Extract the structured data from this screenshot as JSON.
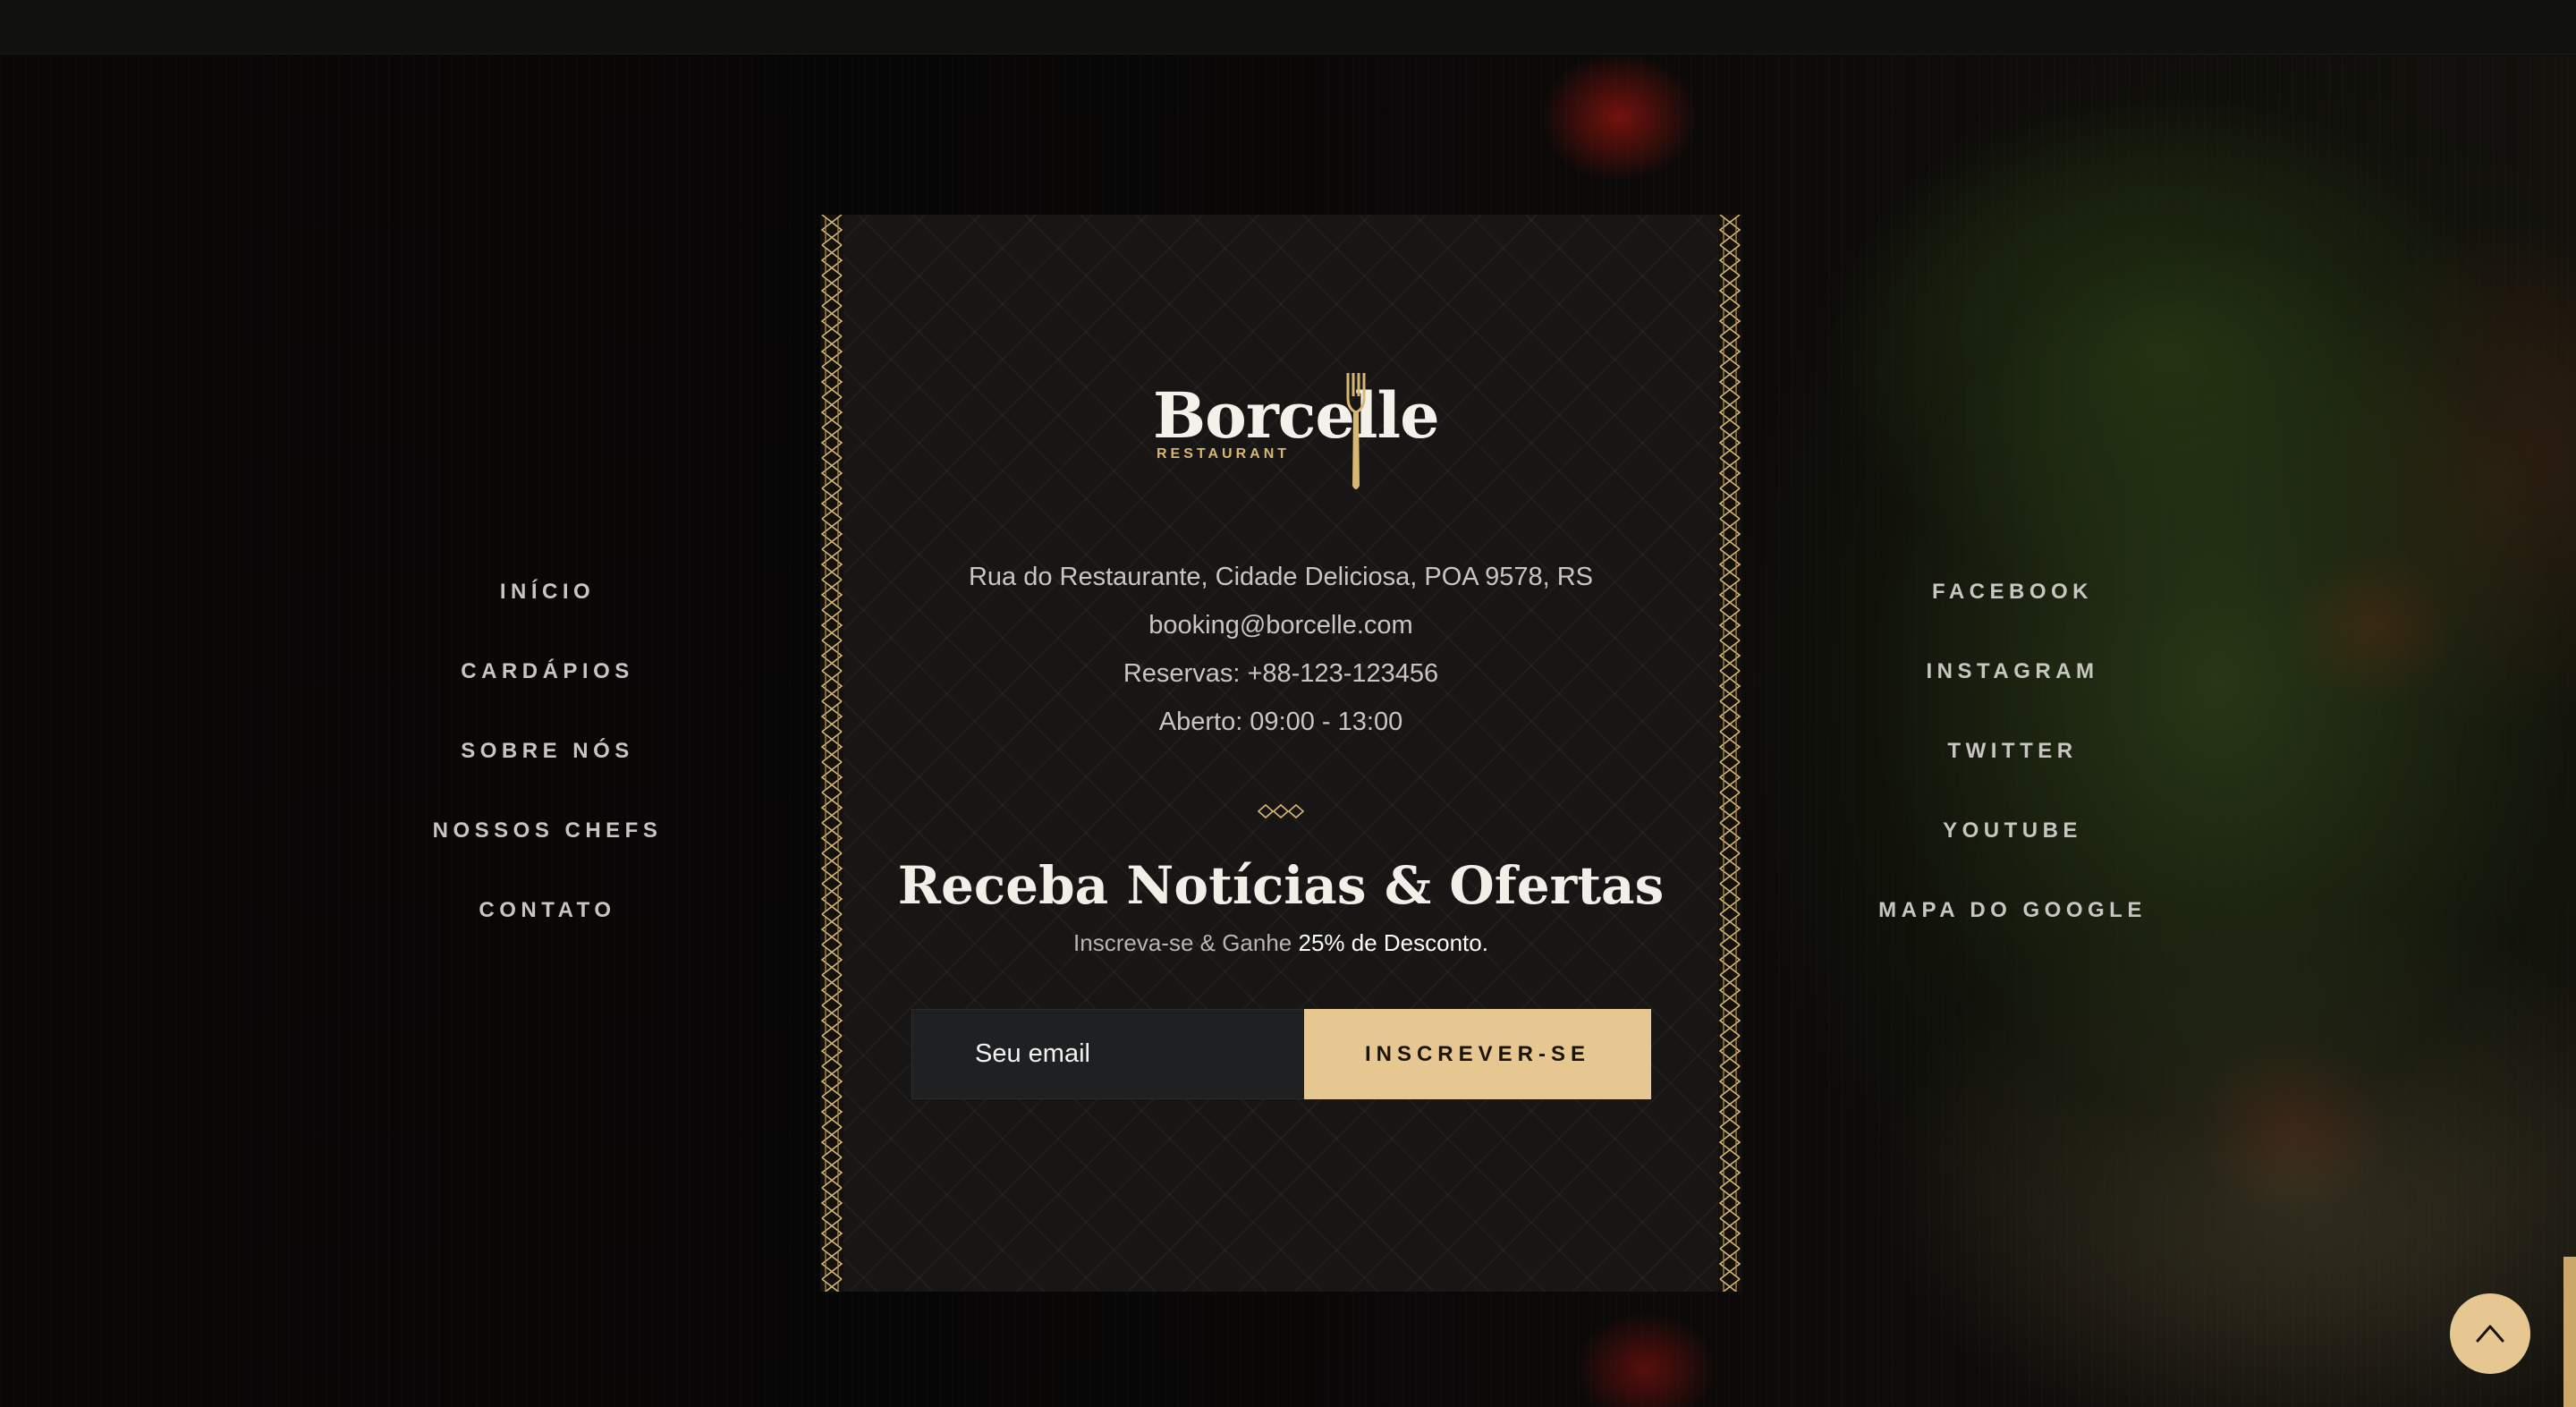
{
  "colors": {
    "accent_gold": "#e6c792",
    "background": "#0a0a0a",
    "card": "#171614",
    "nav_text": "#c8c6c2"
  },
  "brand": {
    "name": "Borcelle",
    "tagline": "RESTAURANT"
  },
  "nav_left": [
    {
      "label": "INÍCIO"
    },
    {
      "label": "CARDÁPIOS"
    },
    {
      "label": "SOBRE NÓS"
    },
    {
      "label": "NOSSOS CHEFS"
    },
    {
      "label": "CONTATO"
    }
  ],
  "nav_right": [
    {
      "label": "FACEBOOK"
    },
    {
      "label": "INSTAGRAM"
    },
    {
      "label": "TWITTER"
    },
    {
      "label": "YOUTUBE"
    },
    {
      "label": "MAPA DO GOOGLE"
    }
  ],
  "contact": {
    "address": "Rua do Restaurante, Cidade Deliciosa, POA 9578, RS",
    "email": "booking@borcelle.com",
    "reservations": "Reservas: +88-123-123456",
    "hours": "Aberto: 09:00 - 13:00"
  },
  "newsletter": {
    "title": "Receba Notícias & Ofertas",
    "subtitle_prefix": "Inscreva-se & Ganhe ",
    "subtitle_highlight": "25% de Desconto.",
    "email_placeholder": "Seu email",
    "button_label": "INSCREVER-SE"
  },
  "icons": {
    "divider": "diamonds-divider-icon",
    "scroll_top": "chevron-up-icon",
    "logo_fork": "fork-icon"
  }
}
